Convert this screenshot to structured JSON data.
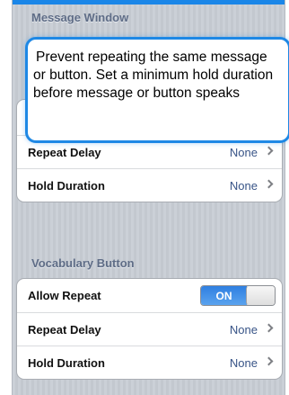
{
  "message_window": {
    "header": "Message Window",
    "rows": [
      {
        "label": "Repeat Delay",
        "value": "None"
      },
      {
        "label": "Hold Duration",
        "value": "None"
      }
    ]
  },
  "vocabulary_button": {
    "header": "Vocabulary Button",
    "allow_repeat": {
      "label": "Allow Repeat",
      "state": "ON"
    },
    "rows": [
      {
        "label": "Repeat Delay",
        "value": "None"
      },
      {
        "label": "Hold Duration",
        "value": "None"
      }
    ]
  },
  "callout": {
    "text": "Prevent repeating the same message or button. Set a minimum hold duration before message or button speaks"
  },
  "colors": {
    "accent": "#1e88e5",
    "toggle_on": "#3a86e3",
    "value_text": "#385487",
    "header_text": "#5e6c86"
  }
}
